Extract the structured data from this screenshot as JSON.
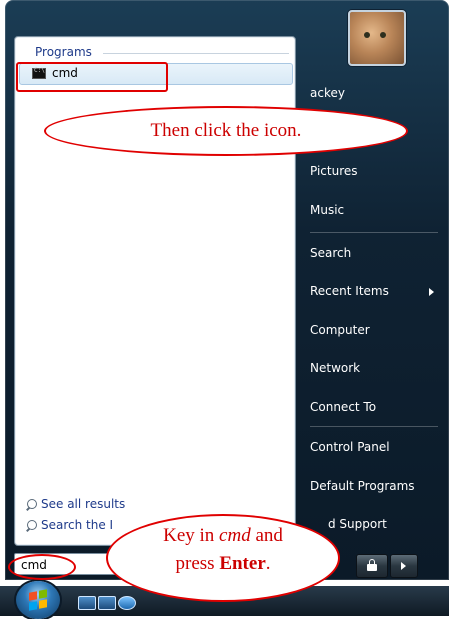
{
  "left_pane": {
    "section_header": "Programs",
    "result_item": "cmd",
    "see_all": "See all results",
    "search_the": "Search the I"
  },
  "search": {
    "value": "cmd"
  },
  "right_pane": {
    "items": [
      {
        "label": "ackey"
      },
      {
        "label": "Pictures"
      },
      {
        "label": "Music"
      },
      {
        "label": "Search"
      },
      {
        "label": "Recent Items"
      },
      {
        "label": "Computer"
      },
      {
        "label": "Network"
      },
      {
        "label": "Connect To"
      },
      {
        "label": "Control Panel"
      },
      {
        "label": "Default Programs"
      },
      {
        "label": "d Support"
      }
    ]
  },
  "callouts": {
    "top": "Then click the icon.",
    "bottom_line1_pre": "Key in ",
    "bottom_line1_em": "cmd",
    "bottom_line1_post": " and",
    "bottom_line2_pre": "press ",
    "bottom_line2_strong": "Enter",
    "bottom_line2_post": "."
  },
  "icons": {
    "start_orb": "windows-logo-icon",
    "cmd": "command-prompt-icon",
    "search": "magnifier-icon",
    "lock": "lock-icon",
    "arrow": "arrow-right-icon"
  }
}
